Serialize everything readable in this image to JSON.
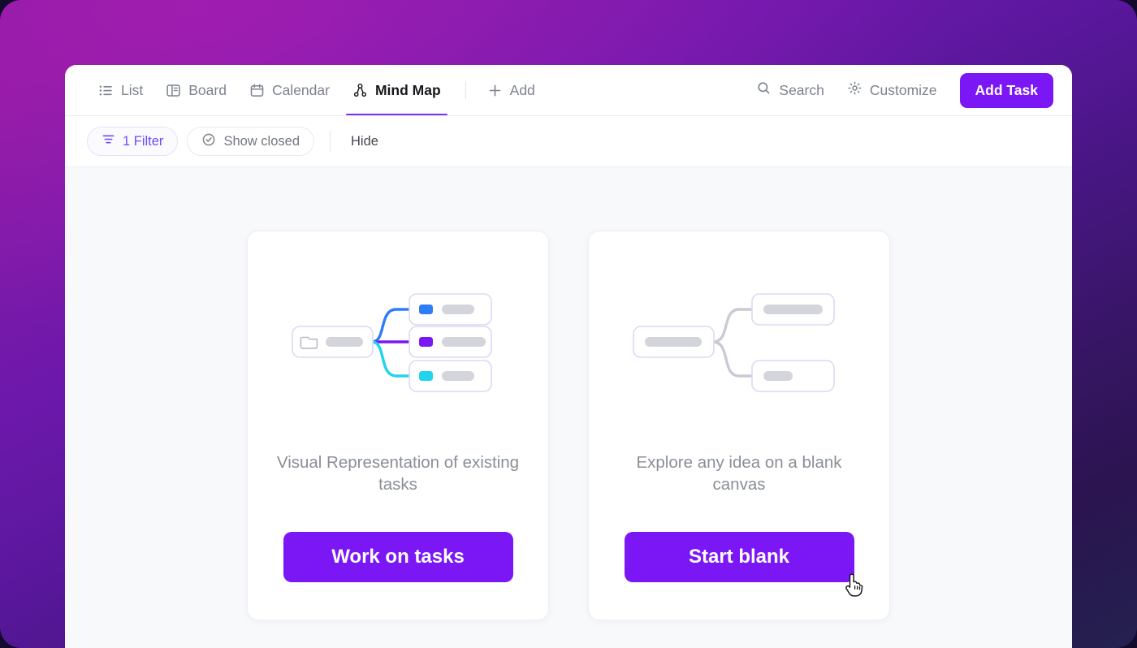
{
  "window": {
    "toolbar": {
      "tabs": [
        {
          "label": "List",
          "icon": "list-icon",
          "active": false
        },
        {
          "label": "Board",
          "icon": "board-icon",
          "active": false
        },
        {
          "label": "Calendar",
          "icon": "calendar-icon",
          "active": false
        },
        {
          "label": "Mind Map",
          "icon": "mindmap-icon",
          "active": true
        }
      ],
      "add_label": "Add",
      "add_icon": "plus-icon",
      "search_label": "Search",
      "search_icon": "search-icon",
      "customize_label": "Customize",
      "customize_icon": "gear-icon",
      "add_task_label": "Add Task"
    },
    "filterbar": {
      "filter_label": "1 Filter",
      "filter_icon": "filter-icon",
      "show_closed_label": "Show closed",
      "show_closed_icon": "check-circle-icon",
      "hide_label": "Hide"
    },
    "cards": [
      {
        "id": "work-on-tasks",
        "caption": "Visual Representation of existing tasks",
        "button_label": "Work on tasks",
        "diagram": {
          "type": "mind-map-preview",
          "variant": "colored",
          "root": {
            "icon": "folder-icon",
            "pill_width": 46
          },
          "children": [
            {
              "badge_color": "#2f7df6",
              "pill_width": 40
            },
            {
              "badge_color": "#7b16f5",
              "pill_width": 54
            },
            {
              "badge_color": "#22d3ee",
              "pill_width": 40
            }
          ],
          "link_colors": [
            "#2f7df6",
            "#7b16f5",
            "#22d3ee"
          ]
        }
      },
      {
        "id": "start-blank",
        "caption": "Explore any idea on a blank canvas",
        "button_label": "Start blank",
        "diagram": {
          "type": "mind-map-preview",
          "variant": "blank",
          "root": {
            "icon": null,
            "pill_width": 62
          },
          "children": [
            {
              "badge_color": null,
              "pill_width": 62
            },
            {
              "badge_color": null,
              "pill_width": 32
            }
          ],
          "link_colors": [
            "#c9cbd4",
            "#c9cbd4"
          ]
        }
      }
    ]
  },
  "cursor": {
    "type": "pointing-hand",
    "on": "start-blank-button"
  },
  "theme": {
    "accent": "#7b16f5",
    "filter_accent": "#6d4aff",
    "node_border": "#dcd9f4",
    "pill_gray": "#d3d5db",
    "canvas_bg": "#f8f9fb",
    "backdrop_from": "#8a1a9e",
    "backdrop_to": "#23214f"
  }
}
